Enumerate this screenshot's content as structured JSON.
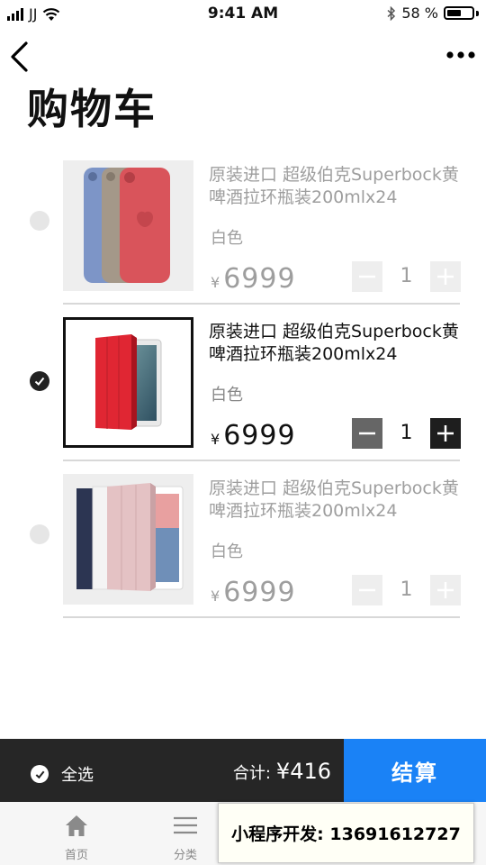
{
  "status_bar": {
    "carrier": "JJ",
    "time": "9:41 AM",
    "battery_percent": "58 %",
    "battery_level": 0.58
  },
  "header": {
    "title": "购物车",
    "back_icon": "chevron-left-icon",
    "more_icon": "more-horizontal-icon"
  },
  "items": [
    {
      "title": "原装进口 超级伯克Superbock黄啤酒拉环瓶装200mlx24",
      "spec": "白色",
      "currency": "¥",
      "price": "6999",
      "quantity": "1",
      "selected": false,
      "image": "iphone-case-colors"
    },
    {
      "title": "原装进口 超级伯克Superbock黄啤酒拉环瓶装200mlx24",
      "spec": "白色",
      "currency": "¥",
      "price": "6999",
      "quantity": "1",
      "selected": true,
      "image": "ipad-smart-cover-red"
    },
    {
      "title": "原装进口 超级伯克Superbock黄啤酒拉环瓶装200mlx24",
      "spec": "白色",
      "currency": "¥",
      "price": "6999",
      "quantity": "1",
      "selected": false,
      "image": "ipad-smart-cover-pink"
    }
  ],
  "checkout": {
    "select_all_label": "全选",
    "total_label": "合计:",
    "total_amount": "¥416",
    "checkout_label": "结算"
  },
  "tabs": [
    {
      "label": "首页",
      "icon": "home-icon"
    },
    {
      "label": "分类",
      "icon": "menu-icon"
    }
  ],
  "promo": {
    "text": "小程序开发: 13691612727"
  },
  "colors": {
    "accent": "#1a82f6",
    "dark_bar": "#262626"
  }
}
